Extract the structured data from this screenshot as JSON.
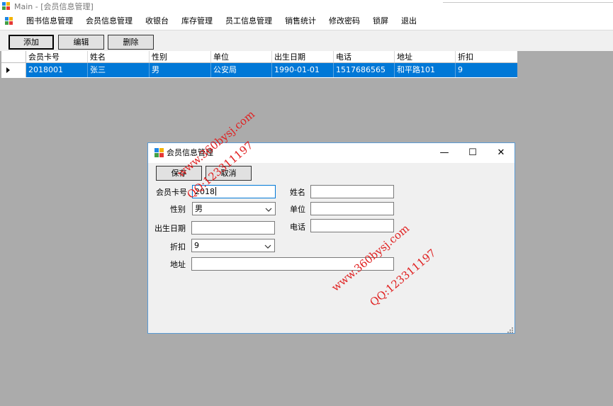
{
  "window": {
    "title": "Main - [会员信息管理]"
  },
  "menu": [
    "图书信息管理",
    "会员信息管理",
    "收银台",
    "库存管理",
    "员工信息管理",
    "销售统计",
    "修改密码",
    "锁屏",
    "退出"
  ],
  "toolbar": {
    "add": "添加",
    "edit": "编辑",
    "delete": "删除"
  },
  "grid": {
    "columns": [
      "会员卡号",
      "姓名",
      "性别",
      "单位",
      "出生日期",
      "电话",
      "地址",
      "折扣"
    ],
    "rows": [
      [
        "2018001",
        "张三",
        "男",
        "公安局",
        "1990-01-01",
        "1517686565",
        "和平路101",
        "9"
      ]
    ]
  },
  "dialog": {
    "title": "会员信息管理",
    "save": "保存",
    "cancel": "取消",
    "labels": {
      "card_no": "会员卡号",
      "gender": "性别",
      "birthdate": "出生日期",
      "discount": "折扣",
      "address": "地址",
      "name": "姓名",
      "unit": "单位",
      "phone": "电话"
    },
    "values": {
      "card_no": "2018",
      "gender": "男",
      "birthdate": "",
      "discount": "9",
      "address": "",
      "name": "",
      "unit": "",
      "phone": ""
    },
    "controls": {
      "minimize": "—",
      "maximize": "☐",
      "close": "✕"
    }
  },
  "watermarks": [
    "www.360bysj.com",
    "QQ:123311197",
    "www.360bysj.com",
    "QQ:123311197"
  ],
  "colors": {
    "selection": "#0078d7",
    "workspace": "#ababab",
    "watermark": "#e02020"
  }
}
